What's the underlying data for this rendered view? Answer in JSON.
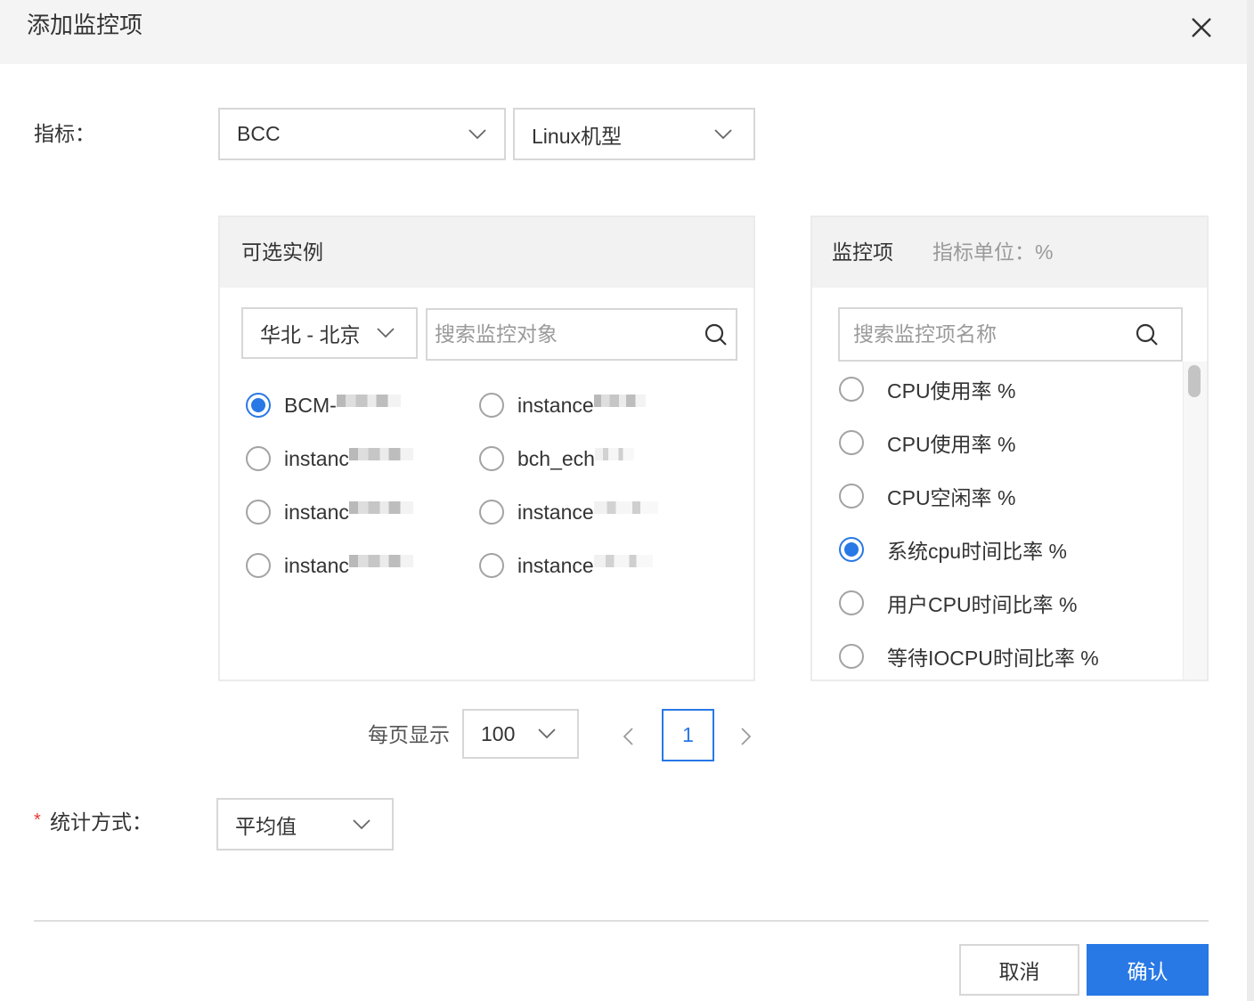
{
  "dialog": {
    "title": "添加监控项"
  },
  "metric": {
    "label": "指标：",
    "product": "BCC",
    "model": "Linux机型"
  },
  "instances": {
    "title": "可选实例",
    "region": "华北 - 北京",
    "search_placeholder": "搜索监控对象",
    "items": [
      {
        "label": "BCM-",
        "selected": true
      },
      {
        "label": "instance",
        "selected": false
      },
      {
        "label": "instanc",
        "selected": false
      },
      {
        "label": "bch_ech",
        "selected": false
      },
      {
        "label": "instanc",
        "selected": false
      },
      {
        "label": "instance",
        "selected": false
      },
      {
        "label": "instanc",
        "selected": false
      },
      {
        "label": "instance",
        "selected": false
      }
    ]
  },
  "monitor_items": {
    "title": "监控项",
    "unit_label": "指标单位：%",
    "search_placeholder": "搜索监控项名称",
    "items": [
      {
        "label": "CPU使用率 %",
        "selected": false
      },
      {
        "label": "CPU使用率 %",
        "selected": false
      },
      {
        "label": "CPU空闲率 %",
        "selected": false
      },
      {
        "label": "系统cpu时间比率 %",
        "selected": true
      },
      {
        "label": "用户CPU时间比率 %",
        "selected": false
      },
      {
        "label": "等待IOCPU时间比率 %",
        "selected": false
      }
    ]
  },
  "pagination": {
    "page_size_label": "每页显示",
    "page_size": "100",
    "current_page": "1"
  },
  "statistic": {
    "required_mark": "*",
    "label": "统计方式：",
    "value": "平均值"
  },
  "footer": {
    "cancel_label": "取消",
    "confirm_label": "确认"
  },
  "icons": {
    "close": "close-icon",
    "search": "search-icon",
    "dropdown": "chevron-down-icon",
    "prev": "chevron-left-icon",
    "next": "chevron-right-icon"
  },
  "colors": {
    "accent": "#2878e5",
    "required": "#e53935",
    "header_bg": "#f4f4f4"
  }
}
